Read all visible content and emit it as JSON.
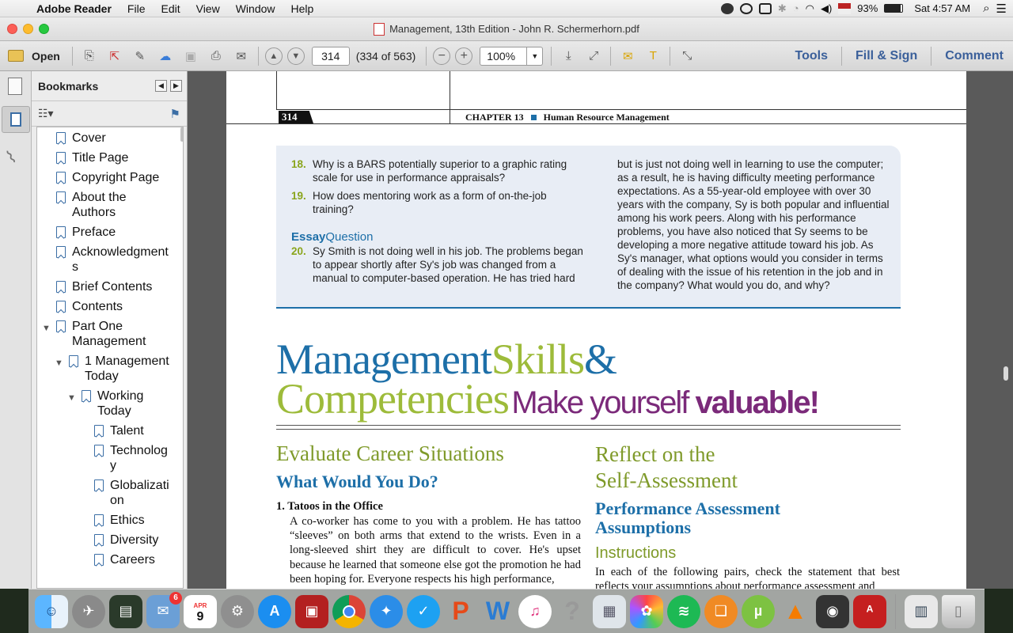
{
  "menubar": {
    "app_name": "Adobe Reader",
    "items": [
      "File",
      "Edit",
      "View",
      "Window",
      "Help"
    ],
    "battery": "93%",
    "clock": "Sat 4:57 AM"
  },
  "window": {
    "title": "Management, 13th Edition - John R. Schermerhorn.pdf"
  },
  "toolbar": {
    "open_label": "Open",
    "page_value": "314",
    "page_count": "(334 of 563)",
    "zoom_value": "100%",
    "tools_label": "Tools",
    "fillsign_label": "Fill & Sign",
    "comment_label": "Comment"
  },
  "bookmarks": {
    "title": "Bookmarks",
    "items": [
      {
        "label": "Cover",
        "indent": 0
      },
      {
        "label": "Title Page",
        "indent": 0
      },
      {
        "label": "Copyright Page",
        "indent": 0
      },
      {
        "label": "About the Authors",
        "indent": 0
      },
      {
        "label": "Preface",
        "indent": 0
      },
      {
        "label": "Acknowledgments",
        "indent": 0
      },
      {
        "label": "Brief Contents",
        "indent": 0
      },
      {
        "label": "Contents",
        "indent": 0
      },
      {
        "label": "Part One Management",
        "indent": 0,
        "expanded": true
      },
      {
        "label": "1 Management Today",
        "indent": 1,
        "expanded": true
      },
      {
        "label": "Working Today",
        "indent": 2,
        "expanded": true
      },
      {
        "label": "Talent",
        "indent": 3
      },
      {
        "label": "Technology",
        "indent": 3
      },
      {
        "label": "Globalization",
        "indent": 3
      },
      {
        "label": "Ethics",
        "indent": 3
      },
      {
        "label": "Diversity",
        "indent": 3
      },
      {
        "label": "Careers",
        "indent": 3
      }
    ]
  },
  "pdf": {
    "page_number": "314",
    "chapter_header": "CHAPTER 13",
    "chapter_title": "Human Resource Management",
    "q18_num": "18.",
    "q18_text": "Why is a BARS potentially superior to a graphic rating scale for use in performance appraisals?",
    "q19_num": "19.",
    "q19_text": "How does mentoring work as a form of on-the-job training?",
    "essay_a": "Essay",
    "essay_b": "Question",
    "q20_num": "20.",
    "q20_text": "Sy Smith is not doing well in his job. The problems began to appear shortly after Sy's job was changed from a manual to computer-based operation. He has tried hard",
    "q20_cont": "but is just not doing well in learning to use the computer; as a result, he is having difficulty meeting performance expectations. As a 55-year-old employee with over 30 years with the company, Sy is both popular and influential among his work peers. Along with his performance problems, you have also noticed that Sy seems to be developing a more negative attitude toward his job. As Sy's manager, what options would you consider in terms of dealing with the issue of his retention in the job and in the company? What would you do, and why?",
    "banner_mgmt": "Management",
    "banner_skills": "Skills",
    "banner_amp": "&",
    "banner_comp": "Competencies",
    "banner_make": "Make yourself ",
    "banner_valuable": "valuable!",
    "left_heading": "Evaluate Career Situations",
    "left_sub": "What Would You Do?",
    "item1_title": "1. Tatoos in the Office",
    "item1_text": "A co-worker has come to you with a problem. He has tattoo “sleeves” on both arms that extend to the wrists. Even in a long-sleeved shirt they are difficult to cover. He's upset because he learned that someone else got the promotion he had been hoping for. Everyone respects his high performance,",
    "right_heading1": "Reflect on the",
    "right_heading2": "Self-Assessment",
    "right_sub1": "Performance Assessment",
    "right_sub2": "Assumptions",
    "instructions": "Instructions",
    "instructions_text": "In each of the following pairs, check the statement that best reflects your assumptions about performance assessment and"
  },
  "dock": {
    "calendar_month": "APR",
    "calendar_day": "9",
    "mail_badge": "6"
  }
}
